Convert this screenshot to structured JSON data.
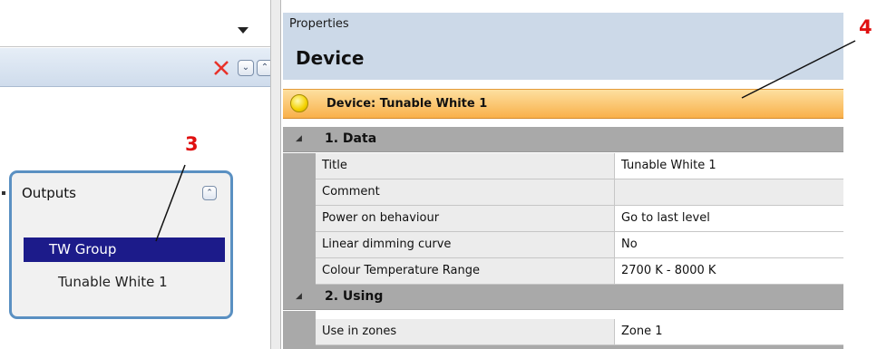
{
  "left_pane": {
    "outputs_title": "Outputs",
    "items": [
      {
        "label": "TW Group",
        "selected": true
      },
      {
        "label": "Tunable White 1",
        "selected": false
      }
    ],
    "toolbar": {
      "delete_icon": "close-x-icon",
      "expand_icon": "double-chevron-down-icon",
      "collapse_icon": "double-chevron-up-icon"
    }
  },
  "properties": {
    "header_label": "Properties",
    "object_type": "Device",
    "device_bar_label": "Device: Tunable White 1",
    "categories": [
      {
        "label": "1. Data",
        "rows": [
          {
            "name": "Title",
            "value": "Tunable White 1"
          },
          {
            "name": "Comment",
            "value": ""
          },
          {
            "name": "Power on behaviour",
            "value": "Go to last level"
          },
          {
            "name": "Linear dimming curve",
            "value": "No"
          },
          {
            "name": "Colour Temperature Range",
            "value": "2700 K - 8000 K"
          }
        ]
      },
      {
        "label": "2. Using",
        "rows": [
          {
            "name": "Use in zones",
            "value": "Zone 1"
          }
        ]
      }
    ]
  },
  "annotations": [
    {
      "label": "3"
    },
    {
      "label": "4"
    }
  ],
  "colors": {
    "accent_red": "#e01010",
    "selection": "#1c1b8a",
    "device_bar": "#f9b04a",
    "outputs_border": "#5a90c2"
  }
}
